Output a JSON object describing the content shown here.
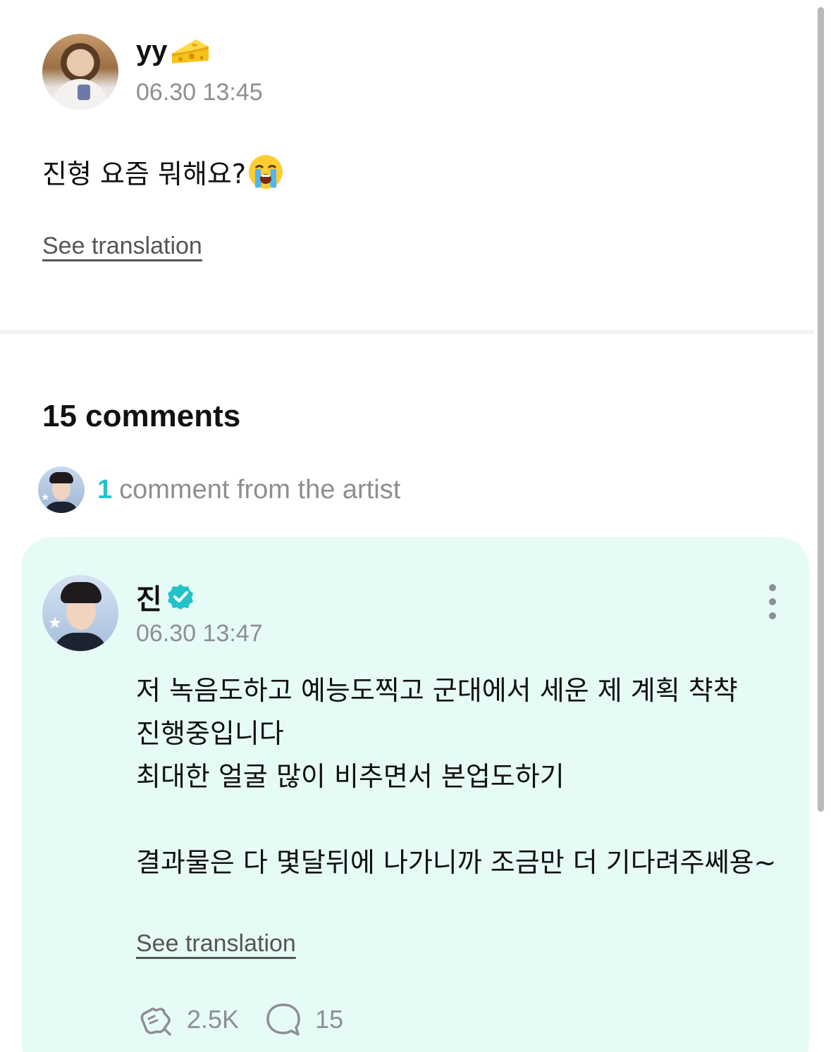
{
  "post": {
    "author_name": "yy",
    "author_badge_icon": "cheese-icon",
    "timestamp": "06.30 13:45",
    "text": "진형 요즘 뭐해요?",
    "text_emoji_icon": "loudly-crying-face-icon",
    "translate_label": "See translation"
  },
  "comments": {
    "count_label": "15 comments",
    "artist_count": "1",
    "artist_label": "comment from the artist"
  },
  "artist_comment": {
    "author_name": "진",
    "verified_icon": "verified-badge-icon",
    "timestamp": "06.30 13:47",
    "text": "저 녹음도하고 예능도찍고 군대에서 세운 제 계획 챡챡 진행중입니다\n최대한 얼굴 많이 비추면서 본업도하기\n\n결과물은 다 몇달뒤에 나가니까 조금만 더 기다려주쎄용~",
    "translate_label": "See translation",
    "like_count": "2.5K",
    "reply_count": "15"
  },
  "colors": {
    "accent": "#22c3c8",
    "card_background": "#e6fbf6",
    "secondary_text": "#8e8e93"
  }
}
